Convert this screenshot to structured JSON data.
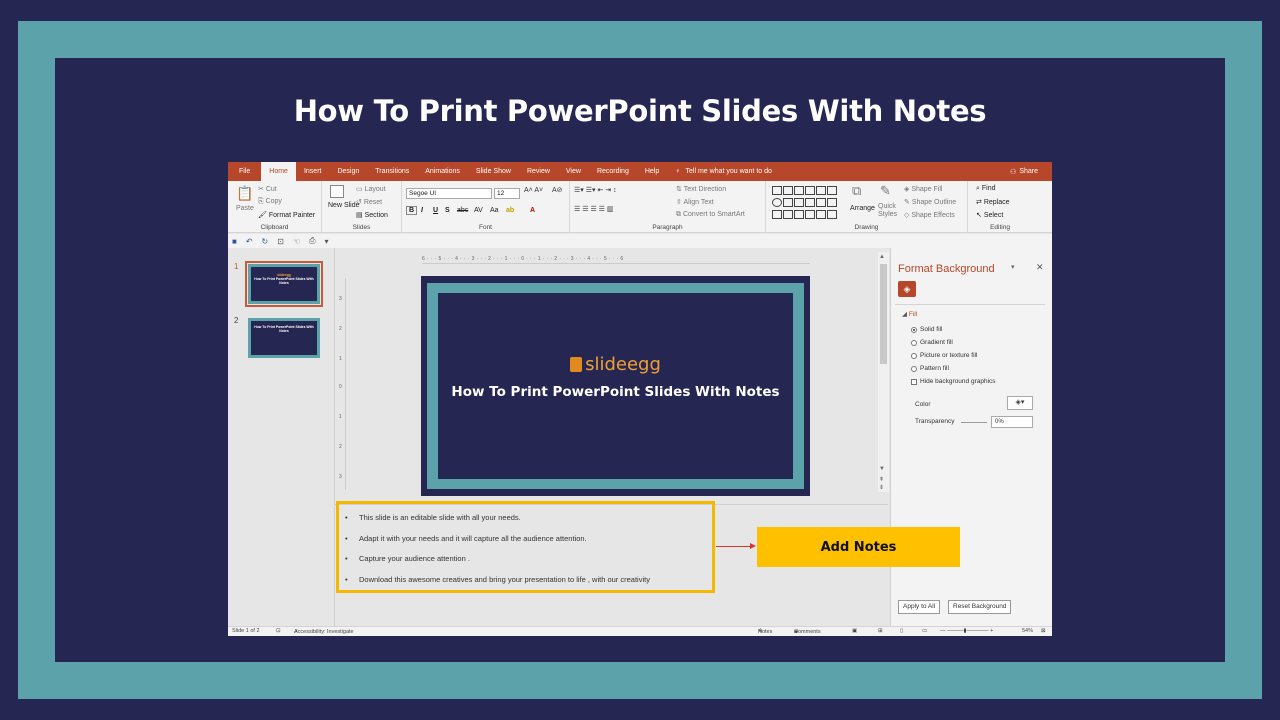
{
  "page_title": "How To Print PowerPoint Slides With Notes",
  "menu": {
    "tabs": [
      "File",
      "Home",
      "Insert",
      "Design",
      "Transitions",
      "Animations",
      "Slide Show",
      "Review",
      "View",
      "Recording",
      "Help"
    ],
    "active_tab": "Home",
    "tell_me": "Tell me what you want to do",
    "share": "Share"
  },
  "ribbon": {
    "clipboard": {
      "label": "Clipboard",
      "paste": "Paste",
      "cut": "Cut",
      "copy": "Copy",
      "format_painter": "Format Painter"
    },
    "slides": {
      "label": "Slides",
      "new_slide": "New Slide",
      "layout": "Layout",
      "reset": "Reset",
      "section": "Section"
    },
    "font": {
      "label": "Font",
      "font_name": "Segoe UI",
      "font_size": "12"
    },
    "paragraph": {
      "label": "Paragraph",
      "text_direction": "Text Direction",
      "align_text": "Align Text",
      "convert_smartart": "Convert to SmartArt"
    },
    "drawing": {
      "label": "Drawing",
      "arrange": "Arrange",
      "quick_styles": "Quick Styles",
      "shape_fill": "Shape Fill",
      "shape_outline": "Shape Outline",
      "shape_effects": "Shape Effects"
    },
    "editing": {
      "label": "Editing",
      "find": "Find",
      "replace": "Replace",
      "select": "Select"
    }
  },
  "thumbnails": [
    {
      "number": "1",
      "title": "How To Print PowerPoint Slides With Notes",
      "logo": "slideegg",
      "selected": true
    },
    {
      "number": "2",
      "title": "How To Print PowerPoint Slides With Notes",
      "selected": false
    }
  ],
  "ruler_h": "6 · · · 5 · · · 4 · · · 3 · · · 2 · · · 1 · · · 0 · · · 1 · · · 2 · · · 3 · · · 4 · · · 5 · · · 6",
  "slide": {
    "logo": "slideegg",
    "title": "How To Print PowerPoint Slides With Notes"
  },
  "notes": [
    "This slide is an editable slide with all your needs.",
    "Adapt it with your needs and it will capture all the audience attention.",
    "Capture your audience attention .",
    "Download this awesome creatives and bring your presentation to life , with our creativity"
  ],
  "format_panel": {
    "title": "Format Background",
    "section": "Fill",
    "options": [
      {
        "label": "Solid fill",
        "checked": true
      },
      {
        "label": "Gradient fill",
        "checked": false
      },
      {
        "label": "Picture or texture fill",
        "checked": false
      },
      {
        "label": "Pattern fill",
        "checked": false
      }
    ],
    "hide_graphics": "Hide background graphics",
    "color_label": "Color",
    "transparency_label": "Transparency",
    "transparency_value": "0%",
    "apply_all": "Apply to All",
    "reset_background": "Reset Background"
  },
  "status": {
    "slide_count": "Slide 1 of 2",
    "accessibility": "Accessibility: Investigate",
    "notes": "Notes",
    "comments": "Comments",
    "zoom": "54%"
  },
  "callout": "Add Notes",
  "colors": {
    "navy": "#262653",
    "teal": "#5ba2ab",
    "ppt_red": "#b7472a",
    "callout": "#ffc000"
  }
}
